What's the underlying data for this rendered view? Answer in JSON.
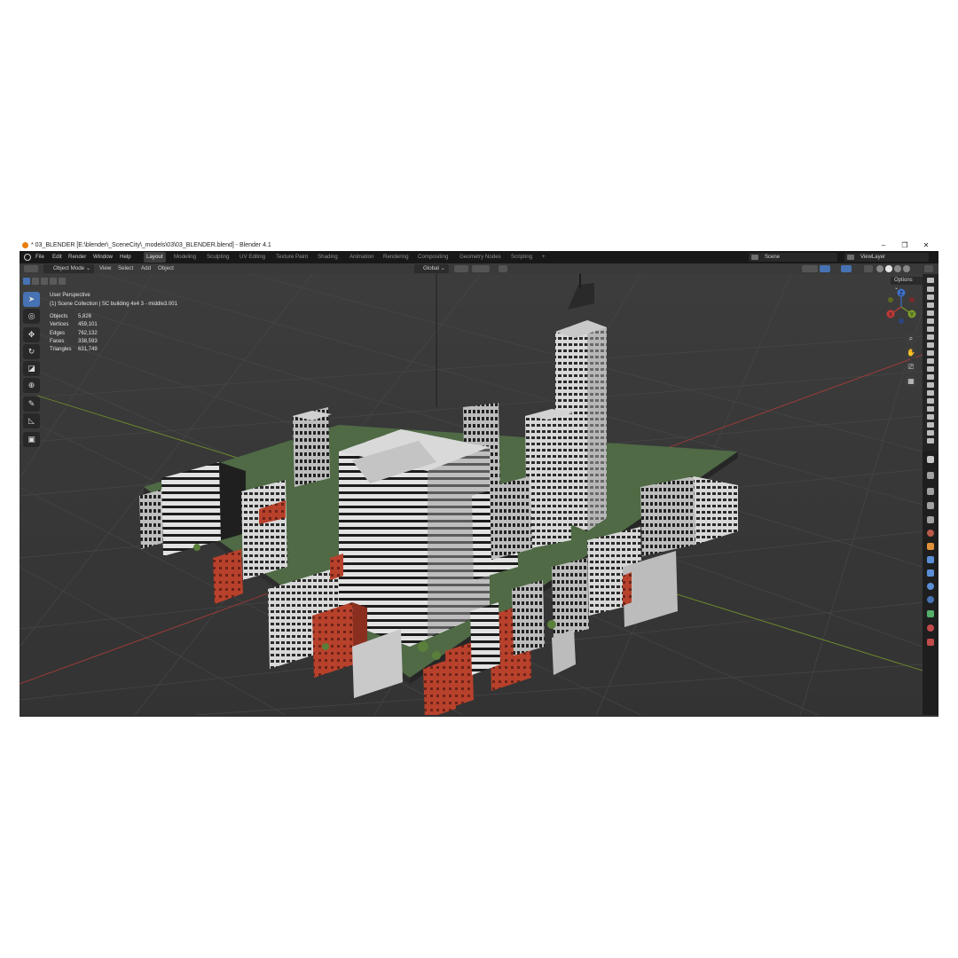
{
  "window": {
    "title": "* 03_BLENDER [E:\\blender\\_SceneCity\\_models\\03\\03_BLENDER.blend] - Blender 4.1",
    "minimize": "–",
    "maximize": "❐",
    "close": "✕"
  },
  "menu": [
    "File",
    "Edit",
    "Render",
    "Window",
    "Help"
  ],
  "workspaces": [
    "Layout",
    "Modeling",
    "Sculpting",
    "UV Editing",
    "Texture Paint",
    "Shading",
    "Animation",
    "Rendering",
    "Compositing",
    "Geometry Nodes",
    "Scripting"
  ],
  "active_workspace": "Layout",
  "add_workspace": "+",
  "scene": {
    "label": "Scene"
  },
  "view_layer": {
    "label": "ViewLayer"
  },
  "viewport_header": {
    "mode": "Object Mode",
    "menus": [
      "View",
      "Select",
      "Add",
      "Object"
    ],
    "transform_orientation": "Global"
  },
  "overlay": {
    "view_name": "User Perspective",
    "collection": "(1) Scene Collection | SC building 4x4 3 - middle3.001"
  },
  "stats": [
    {
      "label": "Objects",
      "value": "5,826"
    },
    {
      "label": "Vertices",
      "value": "459,101"
    },
    {
      "label": "Edges",
      "value": "762,132"
    },
    {
      "label": "Faces",
      "value": "338,593"
    },
    {
      "label": "Triangles",
      "value": "631,749"
    }
  ],
  "options_label": "Options",
  "gizmo": {
    "x": "X",
    "y": "Y",
    "z": "Z"
  },
  "tools": [
    "select-box-icon",
    "cursor-icon",
    "move-icon",
    "rotate-icon",
    "scale-icon",
    "transform-icon",
    "annotate-icon",
    "measure-icon",
    "add-cube-icon"
  ],
  "colors": {
    "accent": "#4772b3",
    "brick": "#b8412c",
    "x_axis": "#c23a3a",
    "y_axis": "#7a9a2a"
  }
}
